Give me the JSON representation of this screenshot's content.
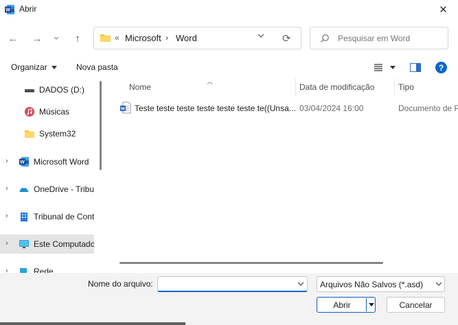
{
  "window": {
    "title": "Abrir",
    "app_icon": "word-icon",
    "close_icon": "close-icon"
  },
  "nav": {
    "back_icon": "arrow-left-icon",
    "forward_icon": "arrow-right-icon",
    "recent_icon": "chevron-down-icon",
    "up_icon": "arrow-up-icon"
  },
  "address": {
    "overflow": "«",
    "crumbs": [
      "Microsoft",
      "Word"
    ],
    "separator": "›",
    "refresh_icon": "refresh-icon"
  },
  "search": {
    "placeholder": "Pesquisar em Word"
  },
  "toolbar": {
    "organize": "Organizar",
    "new_folder": "Nova pasta",
    "view_icon": "view-list-icon",
    "preview_icon": "preview-pane-icon",
    "help": "?"
  },
  "sidebar": {
    "items": [
      {
        "label": "DADOS (D:)",
        "icon": "drive-icon",
        "expandable": false,
        "selected": false
      },
      {
        "label": "Músicas",
        "icon": "music-icon",
        "expandable": false,
        "selected": false
      },
      {
        "label": "System32",
        "icon": "folder-icon",
        "expandable": false,
        "selected": false
      },
      {
        "label": "Microsoft Word",
        "icon": "word-icon",
        "expandable": true,
        "selected": false
      },
      {
        "label": "OneDrive - Tribur",
        "icon": "onedrive-icon",
        "expandable": true,
        "selected": false
      },
      {
        "label": "Tribunal de Cont",
        "icon": "building-icon",
        "expandable": true,
        "selected": false
      },
      {
        "label": "Este Computado",
        "icon": "monitor-icon",
        "expandable": true,
        "selected": true
      },
      {
        "label": "Rede",
        "icon": "network-icon",
        "expandable": true,
        "selected": false
      }
    ]
  },
  "columns": {
    "name": "Nome",
    "date": "Data de modificação",
    "type": "Tipo"
  },
  "files": [
    {
      "name": "Teste teste teste teste teste teste te((Unsa...",
      "date": "03/04/2024 16:00",
      "type": "Documento de R",
      "icon": "word-doc-icon"
    }
  ],
  "footer": {
    "filename_label": "Nome do arquivo:",
    "filename_value": "",
    "filetype": "Arquivos Não Salvos (*.asd)",
    "open": "Abrir",
    "cancel": "Cancelar"
  },
  "colors": {
    "accent": "#0a5fc4",
    "selected_bg": "#e4e4e4",
    "footer_bg": "#f3f3f3"
  }
}
